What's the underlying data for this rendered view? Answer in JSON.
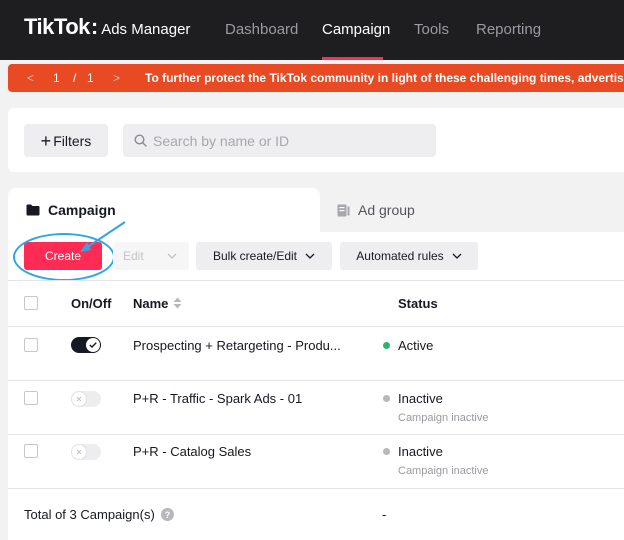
{
  "header": {
    "logo_main": "TikTok",
    "logo_colon": ":",
    "logo_sub": "Ads Manager",
    "nav": [
      {
        "label": "Dashboard"
      },
      {
        "label": "Campaign"
      },
      {
        "label": "Tools"
      },
      {
        "label": "Reporting"
      }
    ],
    "active_nav": "Campaign"
  },
  "announcement": {
    "prev_icon": "<",
    "current_page": "1",
    "separator": "/",
    "total_pages": "1",
    "next_icon": ">",
    "text": "To further protect the TikTok community in light of these challenging times, advertising on TikTok"
  },
  "filters": {
    "plus": "+",
    "button_label": "Filters",
    "search_placeholder": "Search by name or ID"
  },
  "tabs": [
    {
      "label": "Campaign",
      "icon": "folder-icon",
      "active": true
    },
    {
      "label": "Ad group",
      "icon": "ad-group-icon",
      "active": false
    }
  ],
  "toolbar": {
    "create_label": "Create",
    "edit_label": "Edit",
    "bulk_label": "Bulk create/Edit",
    "automated_label": "Automated rules"
  },
  "table": {
    "headers": {
      "onoff": "On/Off",
      "name": "Name",
      "status": "Status"
    },
    "rows": [
      {
        "on": true,
        "name": "Prospecting + Retargeting - Produ...",
        "status": "Active",
        "status_color": "#2db36b",
        "substatus": ""
      },
      {
        "on": false,
        "name": "P+R - Traffic - Spark Ads - 01",
        "status": "Inactive",
        "status_color": "#b7b7bc",
        "substatus": "Campaign inactive"
      },
      {
        "on": false,
        "name": "P+R - Catalog Sales",
        "status": "Inactive",
        "status_color": "#b7b7bc",
        "substatus": "Campaign inactive"
      }
    ],
    "footer": {
      "total": "Total of 3 Campaign(s)",
      "help_icon": "?",
      "status_total": "-"
    }
  },
  "colors": {
    "brand": "#fe2c55",
    "announcement": "#e84a24",
    "highlight": "#2ea6e6"
  }
}
